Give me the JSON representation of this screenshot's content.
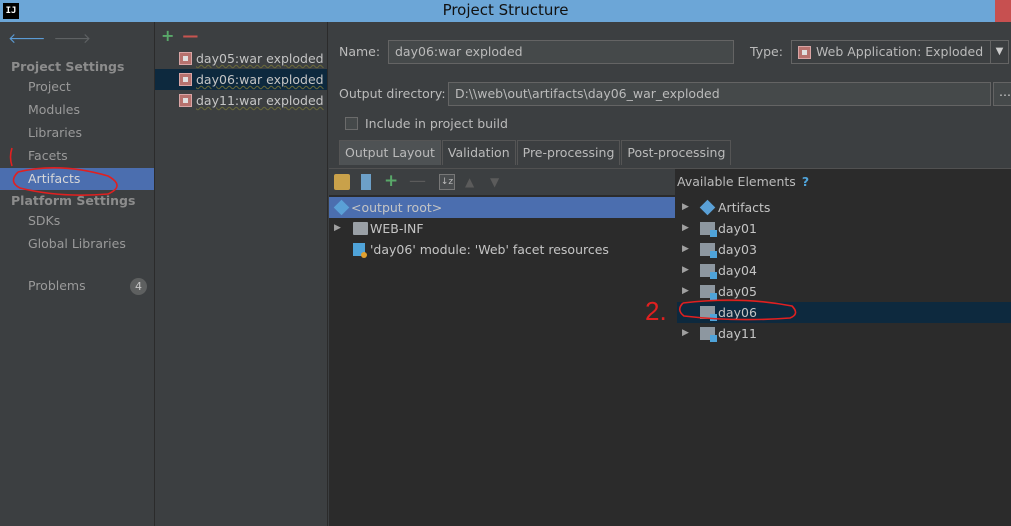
{
  "window": {
    "app_logo": "IJ",
    "title": "Project Structure"
  },
  "left_nav": {
    "back_icon": "arrow-left-icon",
    "forward_icon": "arrow-right-icon",
    "project_settings_header": "Project Settings",
    "project_items": [
      "Project",
      "Modules",
      "Libraries",
      "Facets",
      "Artifacts"
    ],
    "selected_item": "Artifacts",
    "platform_settings_header": "Platform Settings",
    "platform_items": [
      "SDKs",
      "Global Libraries"
    ],
    "problems_label": "Problems",
    "problems_count": "4"
  },
  "artifacts_list": {
    "add_icon": "+",
    "remove_icon": "—",
    "items": [
      "day05:war exploded",
      "day06:war exploded",
      "day11:war exploded"
    ],
    "selected_item": "day06:war exploded"
  },
  "details": {
    "name_label": "Name:",
    "name_value": "day06:war exploded",
    "type_label": "Type:",
    "type_value": "Web Application: Exploded",
    "output_dir_label": "Output directory:",
    "output_dir_value": "D:\\\\web\\out\\artifacts\\day06_war_exploded",
    "browse_label": "...",
    "include_build_label": "Include in project build",
    "include_build_checked": false
  },
  "tabs": [
    "Output Layout",
    "Validation",
    "Pre-processing",
    "Post-processing"
  ],
  "active_tab": "Output Layout",
  "output_layout": {
    "tree": [
      {
        "label": "<output root>",
        "icon": "artifact-root-icon",
        "selected": true
      },
      {
        "label": "WEB-INF",
        "icon": "folder-icon",
        "expandable": true
      },
      {
        "label": "'day06' module: 'Web' facet resources",
        "icon": "web-facet-icon"
      }
    ]
  },
  "available_elements": {
    "header": "Available Elements",
    "help_icon": "?",
    "items": [
      "Artifacts",
      "day01",
      "day03",
      "day04",
      "day05",
      "day06",
      "day11"
    ],
    "selected_item": "day06"
  },
  "annotations": {
    "step_2": "2."
  },
  "colors": {
    "title_bar": "#6ca6d7",
    "selection_blue": "#4b6eaf",
    "selection_dark": "#0d293e",
    "annotation_red": "#e02020"
  }
}
